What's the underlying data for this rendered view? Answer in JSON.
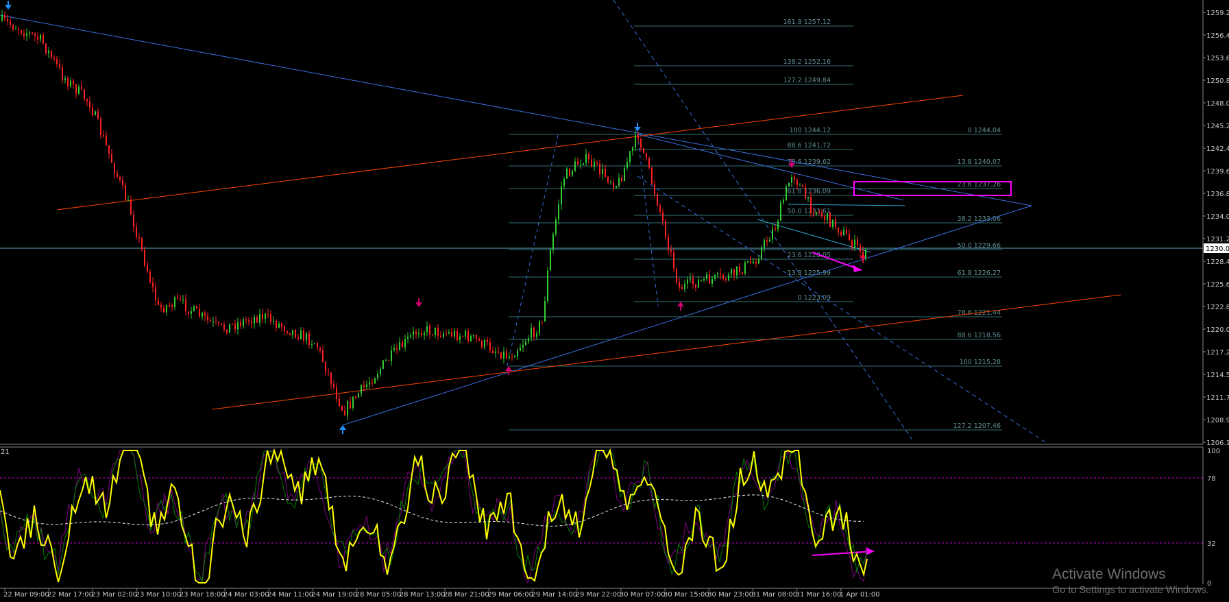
{
  "price_axis_labels": [
    "1259.20",
    "1256.40",
    "1253.65",
    "1250.85",
    "1248.05",
    "1245.25",
    "1242.40",
    "1239.65",
    "1236.85",
    "1234.05",
    "1231.25",
    "1228.45",
    "1225.65",
    "1222.85",
    "1220.05",
    "1217.25",
    "1214.50",
    "1211.70",
    "1208.90",
    "1206.10"
  ],
  "current_price_label": "1230.04",
  "oscillator_axis_labels": [
    "100",
    "78",
    "32",
    "0"
  ],
  "oscillator_tag": "21",
  "time_axis_labels": [
    "22 Mar 09:00",
    "22 Mar 17:00",
    "23 Mar 02:00",
    "23 Mar 10:00",
    "23 Mar 18:00",
    "24 Mar 03:00",
    "24 Mar 11:00",
    "24 Mar 19:00",
    "28 Mar 05:00",
    "28 Mar 13:00",
    "28 Mar 21:00",
    "29 Mar 06:00",
    "29 Mar 14:00",
    "29 Mar 22:00",
    "30 Mar 07:00",
    "30 Mar 15:00",
    "30 Mar 23:00",
    "31 Mar 08:00",
    "31 Mar 16:00",
    "1 Apr 01:00"
  ],
  "fib_levels_upper": [
    "161.8 1257.12",
    "138.2 1252.16",
    "127.2 1249.84",
    "100 1244.12",
    "88.6 1241.72",
    "78.6 1239.62",
    "61.8 1236.09",
    "50.0 1233.61",
    "23.6 1228.05",
    "13.8 1225.99",
    "0 1223.09"
  ],
  "fib_levels_lower": [
    "0 1244.04",
    "13.8 1240.07",
    "23.6 1237.26",
    "38.2 1233.06",
    "50.0 1229.66",
    "61.8 1226.27",
    "78.6 1221.44",
    "88.6 1218.56",
    "100 1215.28",
    "127.2 1207.46"
  ],
  "colors": {
    "background": "#000000",
    "bull_candle": "#32cd32",
    "bear_candle": "#ff2020",
    "trend_blue": "#3a6fe0",
    "channel_red": "#ff4500",
    "fib_line": "#2f6f73",
    "highlight_magenta": "#ff00ff",
    "oscillator_main": "#ffff00",
    "oscillator_signal": "#008000",
    "oscillator_signal2": "#800080",
    "arrow_blue": "#1e90ff",
    "arrow_magenta": "#d00070"
  },
  "watermark": {
    "title": "Activate Windows",
    "subtitle": "Go to Settings to activate Windows."
  }
}
